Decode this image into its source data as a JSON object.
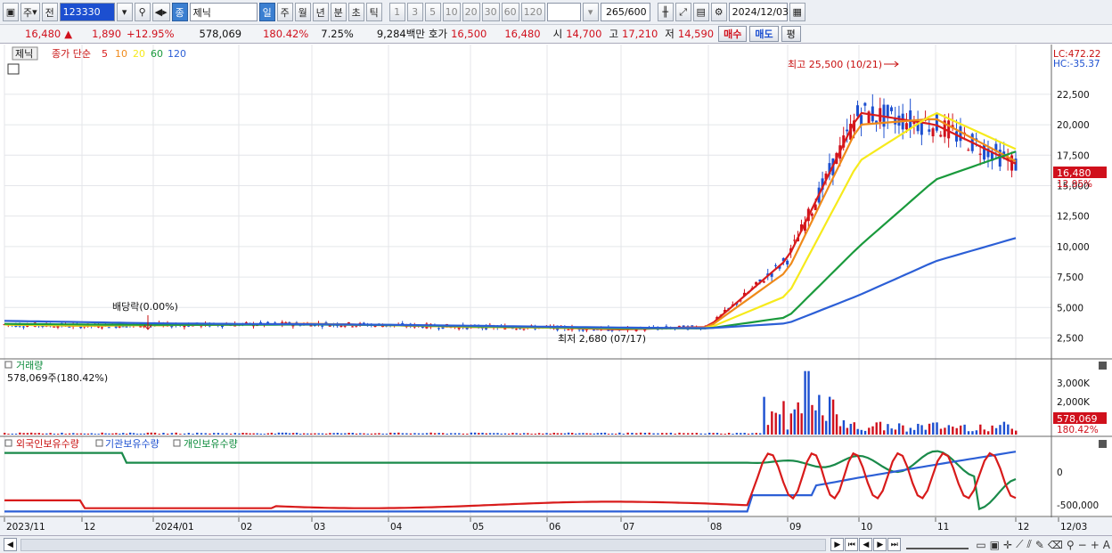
{
  "toolbar": {
    "market": "주",
    "prev": "전",
    "code": "123330",
    "sub_icon": "종",
    "stock_name": "제닉",
    "periods": [
      "일",
      "주",
      "월",
      "년",
      "분",
      "초",
      "틱"
    ],
    "nums": [
      "1",
      "3",
      "5",
      "10",
      "20",
      "30",
      "60",
      "120"
    ],
    "count": "265",
    "count_total": "/600",
    "date": "2024/12/03"
  },
  "quote": {
    "price": "16,480",
    "change": "1,890",
    "change_pct": "+12.95%",
    "volume": "578,069",
    "vol_pct": "180.42%",
    "turnover": "7.25%",
    "amount": "9,284백만",
    "ask_label": "호가",
    "ask1": "16,500",
    "ask2": "16,480",
    "open_label": "시",
    "open": "14,700",
    "high_label": "고",
    "high": "17,210",
    "low_label": "저",
    "low": "14,590",
    "buy": "매수",
    "sell": "매도",
    "eval": "평"
  },
  "price_panel": {
    "tag": "제닉",
    "ma_title": "종가 단순",
    "ma_periods": [
      "5",
      "10",
      "20",
      "60",
      "120"
    ],
    "ma_colors": [
      "#d81b1b",
      "#ef8a1a",
      "#f6ea1c",
      "#1a9a3c",
      "#2c5fd6"
    ],
    "lc": "LC:472.22",
    "hc": "HC:-35.37",
    "high_note": "최고 25,500 (10/21)",
    "low_note": "최저 2,680 (07/17)",
    "div_note": "배당락(0.00%)",
    "yticks": [
      "22,500",
      "20,000",
      "17,500",
      "15,000",
      "12,500",
      "10,000",
      "7,500",
      "5,000",
      "2,500"
    ],
    "last_price": "16,480",
    "last_pct": "12.95%"
  },
  "volume_panel": {
    "title": "거래량",
    "info": "578,069주(180.42%)",
    "yticks": [
      "3,000K",
      "2,000K",
      "1,000K"
    ],
    "last": "578,069",
    "last_pct": "180.42%"
  },
  "holding_panel": {
    "titles": [
      "외국인보유수량",
      "기관보유수량",
      "개인보유수량"
    ],
    "yticks": [
      "0",
      "-500,000"
    ]
  },
  "xaxis": [
    "2023/11",
    "12",
    "2024/01",
    "02",
    "03",
    "04",
    "05",
    "06",
    "07",
    "08",
    "09",
    "10",
    "11",
    "12",
    "12/03"
  ],
  "colors": {
    "up": "#d0101c",
    "down": "#1c4fd0",
    "accent": "#3b7fd1"
  },
  "chart_data": {
    "type": "line",
    "title": "제닉",
    "x": [
      "2023/11",
      "12",
      "2024/01",
      "02",
      "03",
      "04",
      "05",
      "06",
      "07",
      "08",
      "09",
      "10",
      "11",
      "12"
    ],
    "series": [
      {
        "name": "종가 단순 5",
        "values": [
          3600,
          3500,
          3550,
          3600,
          3650,
          3550,
          3400,
          3350,
          3200,
          3400,
          9000,
          21000,
          20000,
          16800
        ]
      },
      {
        "name": "종가 단순 10",
        "values": [
          3600,
          3500,
          3550,
          3600,
          3650,
          3550,
          3400,
          3350,
          3250,
          3350,
          8000,
          20000,
          20500,
          17000
        ]
      },
      {
        "name": "종가 단순 20",
        "values": [
          3600,
          3520,
          3550,
          3600,
          3620,
          3550,
          3420,
          3350,
          3280,
          3300,
          6000,
          17000,
          21000,
          18000
        ]
      },
      {
        "name": "종가 단순 60",
        "values": [
          3650,
          3600,
          3570,
          3580,
          3600,
          3560,
          3450,
          3380,
          3300,
          3280,
          4200,
          10000,
          15500,
          17800
        ]
      },
      {
        "name": "종가 단순 120",
        "values": [
          3900,
          3800,
          3700,
          3650,
          3620,
          3580,
          3500,
          3420,
          3350,
          3300,
          3700,
          6000,
          8800,
          10700
        ]
      }
    ],
    "ylim": [
      1000,
      26000
    ]
  }
}
